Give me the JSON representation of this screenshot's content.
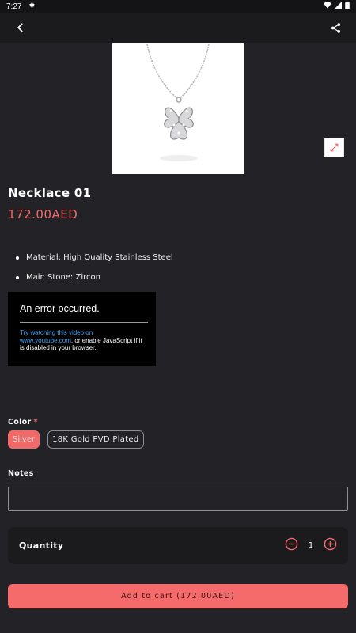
{
  "status_bar": {
    "time": "7:27"
  },
  "product": {
    "title": "Necklace 01",
    "price": "172.00AED",
    "features": [
      "Material: High Quality Stainless Steel",
      "Main Stone: Zircon"
    ]
  },
  "video_error": {
    "title": "An error occurred.",
    "link_text": "Try watching this video on www.youtube.com",
    "message_rest": ", or enable JavaScript if it is disabled in your browser."
  },
  "color": {
    "label": "Color",
    "required_mark": "*",
    "options": [
      "Silver",
      "18K Gold PVD Plated"
    ],
    "selected": "Silver"
  },
  "notes": {
    "label": "Notes",
    "value": ""
  },
  "quantity": {
    "label": "Quantity",
    "value": "1"
  },
  "add_to_cart": {
    "label": "Add to cart (172.00AED)"
  },
  "colors": {
    "accent": "#f06a6a",
    "background": "#232327",
    "card": "#1b1b1e"
  }
}
